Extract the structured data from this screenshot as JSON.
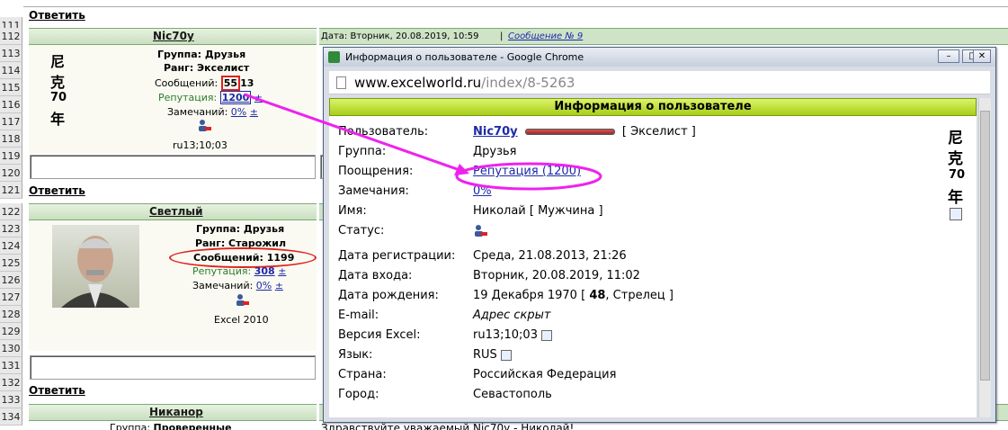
{
  "row_numbers": [
    "111",
    "112",
    "113",
    "114",
    "115",
    "116",
    "117",
    "118",
    "119",
    "120",
    "121",
    "122",
    "123",
    "124",
    "125",
    "126",
    "127",
    "128",
    "129",
    "130",
    "131",
    "132",
    "133",
    "134"
  ],
  "forum": {
    "reply": "Ответить",
    "post1": {
      "username": "Nic70y",
      "date": "Дата: Вторник, 20.08.2019, 10:59",
      "sep": "|",
      "msg": "Сообщение № 9",
      "group": "Группа: Друзья",
      "rank": "Ранг: Экселист",
      "msgs_label": "Сообщений:",
      "msgs_hl": "55",
      "msgs_rest": "13",
      "rep_label": "Репутация:",
      "rep_hl": "1200",
      "pm": "±",
      "warn_label": "Замечаний:",
      "warn_val": "0%",
      "excel": "ru13;10;03",
      "cjk1": "尼",
      "cjk2": "克",
      "cjk3": "70",
      "cjk4": "年"
    },
    "post2": {
      "username": "Светлый",
      "group": "Группа: Друзья",
      "rank": "Ранг: Старожил",
      "msgs_text": "Сообщений: 1199",
      "rep_label": "Репутация:",
      "rep_val": "308",
      "pm": "±",
      "warn_label": "Замечаний:",
      "warn_val": "0%",
      "excel": "Excel 2010"
    },
    "post3": {
      "username": "Никанор",
      "group_label": "Группа:",
      "group_val": "Проверенные",
      "greet": "Здравствуйте уважаемый Nic70y - Николай!"
    }
  },
  "popup": {
    "title": "Информация о пользователе - Google Chrome",
    "url_domain": "www.excelworld.ru",
    "url_path": "/index/8-5263",
    "header": "Информация о пользователе",
    "rows": [
      {
        "label": "Пользователь:",
        "value": "Nic70y",
        "extra": "[ Экселист ]"
      },
      {
        "label": "Группа:",
        "value": "Друзья"
      },
      {
        "label": "Поощрения:",
        "value": "Репутация (1200)"
      },
      {
        "label": "Замечания:",
        "value": "0%"
      },
      {
        "label": "Имя:",
        "value": "Николай [ Мужчина ]"
      },
      {
        "label": "Статус:",
        "value": ""
      },
      {
        "label": "Дата регистрации:",
        "value": "Среда, 21.08.2013, 21:26"
      },
      {
        "label": "Дата входа:",
        "value": "Вторник, 20.08.2019, 11:02"
      },
      {
        "label": "Дата рождения:",
        "value": "19 Декабря 1970 [",
        "age": "48",
        "value2": ", Стрелец ]"
      },
      {
        "label": "E-mail:",
        "value": "Адрес скрыт"
      },
      {
        "label": "Версия Excel:",
        "value": "ru13;10;03"
      },
      {
        "label": "Язык:",
        "value": "RUS"
      },
      {
        "label": "Страна:",
        "value": "Российская Федерация"
      },
      {
        "label": "Город:",
        "value": "Севастополь"
      }
    ],
    "cjk1": "尼",
    "cjk2": "克",
    "cjk3": "70",
    "cjk4": "年"
  },
  "colors": {
    "circle": "#e0201c",
    "arrow": "#ee22ee",
    "header": "#b8dc2a"
  }
}
